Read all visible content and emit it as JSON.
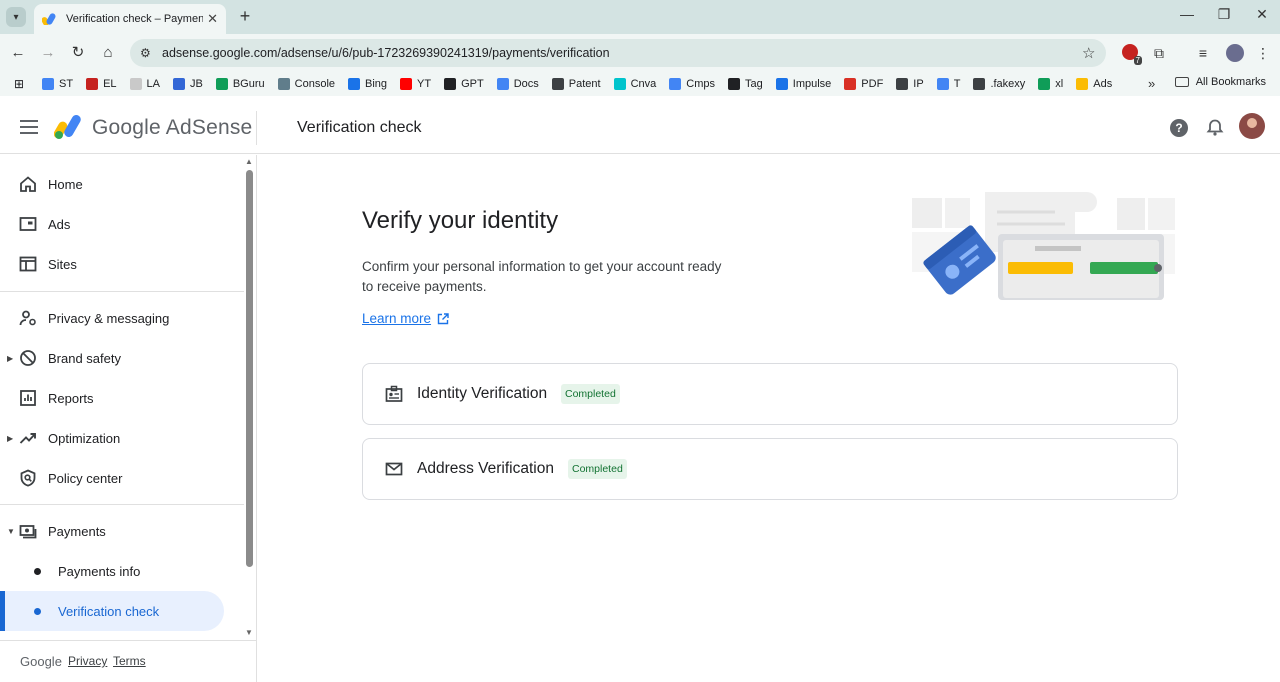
{
  "browser": {
    "tab_title": "Verification check – Payments",
    "url": "adsense.google.com/adsense/u/6/pub-1723269390241319/payments/verification",
    "extension_badge_count": "7",
    "bookmarks": [
      {
        "label": "ST",
        "color": "#4285f4",
        "icon": "google-icon"
      },
      {
        "label": "EL",
        "color": "#c5221f",
        "icon": "el-icon"
      },
      {
        "label": "LA",
        "color": "#c9c9c9",
        "icon": "la-icon"
      },
      {
        "label": "JB",
        "color": "#3367d6",
        "icon": "jb-icon"
      },
      {
        "label": "BGuru",
        "color": "#0f9d58",
        "icon": "bguru-icon"
      },
      {
        "label": "Console",
        "color": "#607d8b",
        "icon": "console-icon"
      },
      {
        "label": "Bing",
        "color": "#1a73e8",
        "icon": "bing-icon"
      },
      {
        "label": "YT",
        "color": "#ff0000",
        "icon": "youtube-icon"
      },
      {
        "label": "GPT",
        "color": "#202124",
        "icon": "openai-icon"
      },
      {
        "label": "Docs",
        "color": "#4285f4",
        "icon": "docs-icon"
      },
      {
        "label": "Patent",
        "color": "#3c4043",
        "icon": "globe-icon"
      },
      {
        "label": "Cnva",
        "color": "#00c4cc",
        "icon": "canva-icon"
      },
      {
        "label": "Cmps",
        "color": "#4285f4",
        "icon": "cmps-icon"
      },
      {
        "label": "Tag",
        "color": "#202124",
        "icon": "tag-icon"
      },
      {
        "label": "Impulse",
        "color": "#1a73e8",
        "icon": "impulse-icon"
      },
      {
        "label": "PDF",
        "color": "#d93025",
        "icon": "pdf-icon"
      },
      {
        "label": "IP",
        "color": "#3c4043",
        "icon": "globe-icon"
      },
      {
        "label": "T",
        "color": "#4285f4",
        "icon": "translate-icon"
      },
      {
        "label": ".fakexy",
        "color": "#3c4043",
        "icon": "globe-icon"
      },
      {
        "label": "xl",
        "color": "#0f9d58",
        "icon": "sheets-icon"
      },
      {
        "label": "Ads",
        "color": "#fbbc04",
        "icon": "ads-icon"
      }
    ],
    "all_bookmarks_label": "All Bookmarks"
  },
  "header": {
    "brand": "Google AdSense",
    "page_title": "Verification check"
  },
  "sidebar": {
    "items": [
      {
        "label": "Home",
        "icon": "home-icon"
      },
      {
        "label": "Ads",
        "icon": "ads-icon"
      },
      {
        "label": "Sites",
        "icon": "sites-icon"
      },
      {
        "label": "Privacy & messaging",
        "icon": "privacy-icon"
      },
      {
        "label": "Brand safety",
        "icon": "block-icon"
      },
      {
        "label": "Reports",
        "icon": "reports-icon"
      },
      {
        "label": "Optimization",
        "icon": "trending-icon"
      },
      {
        "label": "Policy center",
        "icon": "policy-icon"
      },
      {
        "label": "Payments",
        "icon": "payments-icon"
      }
    ],
    "sub_items": [
      {
        "label": "Payments info"
      },
      {
        "label": "Verification check"
      }
    ],
    "footer": {
      "google": "Google",
      "privacy": "Privacy",
      "terms": "Terms"
    }
  },
  "main": {
    "heading": "Verify your identity",
    "description": "Confirm your personal information to get your account ready to receive payments.",
    "learn_more": "Learn more",
    "cards": [
      {
        "label": "Identity Verification",
        "status": "Completed",
        "icon": "id-badge-icon"
      },
      {
        "label": "Address Verification",
        "status": "Completed",
        "icon": "mail-icon"
      }
    ]
  }
}
